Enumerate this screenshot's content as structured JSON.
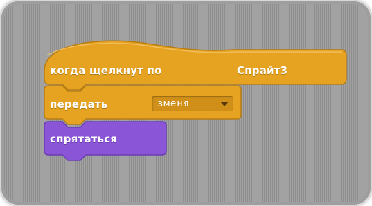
{
  "script": {
    "hat_block": {
      "label": "когда щелкнут по",
      "sprite": "Спрайт3"
    },
    "broadcast_block": {
      "label": "передать",
      "message": "зменя"
    },
    "hide_block": {
      "label": "спрятаться"
    }
  },
  "colors": {
    "events": "#e6a322",
    "events_dark": "#b87d10",
    "looks": "#8a55d7",
    "looks_dark": "#6a3cb4",
    "background": "#9a9a9a"
  },
  "icons": {
    "dropdown": "triangle-down-icon"
  }
}
